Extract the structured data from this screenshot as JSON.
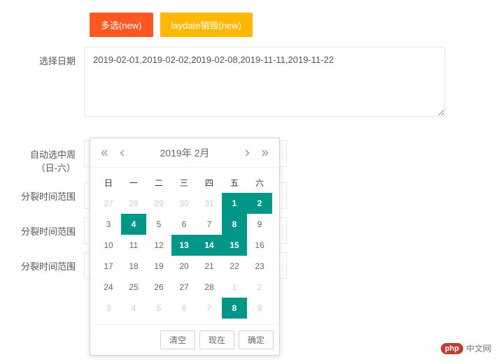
{
  "buttons": {
    "multi": "多选(new)",
    "destroy": "laydate销毁(new)"
  },
  "labels": {
    "chooseDate": "选择日期",
    "autoWeek_l1": "自动选中周",
    "autoWeek_l2": "（日-六）",
    "splitRange1": "分裂时间范围",
    "splitRange2": "分裂时间范围",
    "splitRange3": "分裂时间范围"
  },
  "values": {
    "dates": "2019-02-01,2019-02-02,2019-02-08,2019-11-11,2019-11-22"
  },
  "calendar": {
    "title": "2019年  2月",
    "weekdays": [
      "日",
      "一",
      "二",
      "三",
      "四",
      "五",
      "六"
    ],
    "weeks": [
      [
        {
          "d": 27,
          "o": true
        },
        {
          "d": 28,
          "o": true
        },
        {
          "d": 29,
          "o": true
        },
        {
          "d": 30,
          "o": true
        },
        {
          "d": 31,
          "o": true
        },
        {
          "d": 1,
          "s": true
        },
        {
          "d": 2,
          "s": true
        }
      ],
      [
        {
          "d": 3
        },
        {
          "d": 4,
          "s": true
        },
        {
          "d": 5
        },
        {
          "d": 6
        },
        {
          "d": 7
        },
        {
          "d": 8,
          "s": true
        },
        {
          "d": 9
        }
      ],
      [
        {
          "d": 10
        },
        {
          "d": 11
        },
        {
          "d": 12
        },
        {
          "d": 13,
          "s": true
        },
        {
          "d": 14,
          "s": true
        },
        {
          "d": 15,
          "s": true
        },
        {
          "d": 16
        }
      ],
      [
        {
          "d": 17
        },
        {
          "d": 18
        },
        {
          "d": 19
        },
        {
          "d": 20
        },
        {
          "d": 21
        },
        {
          "d": 22
        },
        {
          "d": 23
        }
      ],
      [
        {
          "d": 24
        },
        {
          "d": 25
        },
        {
          "d": 26
        },
        {
          "d": 27
        },
        {
          "d": 28
        },
        {
          "d": 1,
          "o": true
        },
        {
          "d": 2,
          "o": true
        }
      ],
      [
        {
          "d": 3,
          "o": true
        },
        {
          "d": 4,
          "o": true
        },
        {
          "d": 5,
          "o": true
        },
        {
          "d": 6,
          "o": true
        },
        {
          "d": 7,
          "o": true
        },
        {
          "d": 8,
          "o": true,
          "s": true
        },
        {
          "d": 9,
          "o": true
        }
      ]
    ],
    "footer": {
      "clear": "清空",
      "now": "现在",
      "ok": "确定"
    }
  },
  "logo": {
    "badge": "php",
    "text": "中文网"
  }
}
